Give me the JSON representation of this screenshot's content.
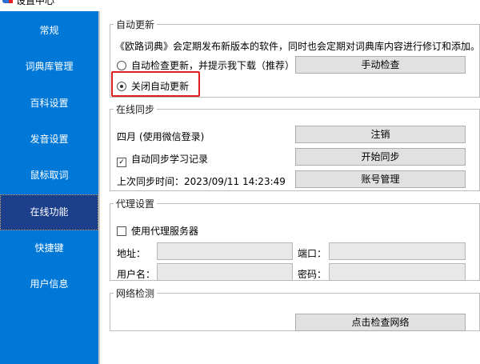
{
  "window": {
    "title": "设置中心"
  },
  "sidebar": {
    "items": [
      {
        "label": "常规"
      },
      {
        "label": "词典库管理"
      },
      {
        "label": "百科设置"
      },
      {
        "label": "发音设置"
      },
      {
        "label": "鼠标取词"
      },
      {
        "label": "在线功能",
        "selected": true
      },
      {
        "label": "快捷键"
      },
      {
        "label": "用户信息"
      }
    ]
  },
  "auto_update": {
    "legend": "自动更新",
    "description": "《欧路词典》会定期发布新版本的软件，同时也会定期对词典库内容进行修订和添加。",
    "option_auto": "自动检查更新，并提示我下载（推荐）",
    "option_off": "关闭自动更新",
    "selected": "option_off",
    "manual_check": "手动检查"
  },
  "online_sync": {
    "legend": "在线同步",
    "user": "四月",
    "login_method": "(使用微信登录)",
    "logout": "注销",
    "auto_sync_label": "自动同步学习记录",
    "auto_sync_checked": true,
    "start_sync": "开始同步",
    "last_sync_label": "上次同步时间：",
    "last_sync_time": "2023/09/11 14:23:49",
    "account_manage": "账号管理"
  },
  "proxy": {
    "legend": "代理设置",
    "use_proxy_label": "使用代理服务器",
    "use_proxy_checked": false,
    "address_label": "地址：",
    "port_label": "端口：",
    "username_label": "用户名：",
    "password_label": "密码：",
    "address": "",
    "port": "",
    "username": "",
    "password": ""
  },
  "network": {
    "legend": "网络检测",
    "check_button": "点击检查网络"
  },
  "colors": {
    "sidebar": "#0078d7",
    "selected": "#1b3f8a",
    "highlight": "#e02020"
  }
}
